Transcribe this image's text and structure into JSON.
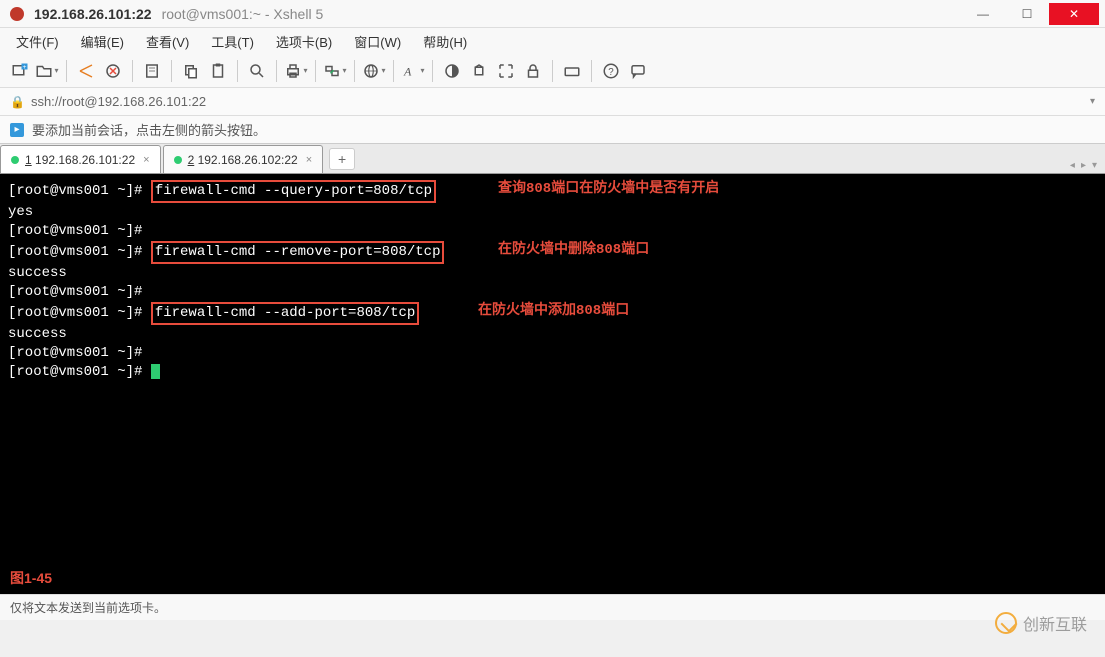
{
  "title": {
    "ip": "192.168.26.101:22",
    "session": "root@vms001:~ - Xshell 5"
  },
  "menu": {
    "file": "文件(F)",
    "edit": "编辑(E)",
    "view": "查看(V)",
    "tools": "工具(T)",
    "tabs": "选项卡(B)",
    "window": "窗口(W)",
    "help": "帮助(H)"
  },
  "address": {
    "url": "ssh://root@192.168.26.101:22"
  },
  "infobar": {
    "text": "要添加当前会话，点击左侧的箭头按钮。"
  },
  "tabs": {
    "t1_num": "1",
    "t1_label": " 192.168.26.101:22",
    "t2_num": "2",
    "t2_label": " 192.168.26.102:22"
  },
  "terminal": {
    "p1": "[root@vms001 ~]# ",
    "cmd1": "firewall-cmd --query-port=808/tcp",
    "ann1": "查询808端口在防火墙中是否有开启",
    "r1": "yes",
    "p2": "[root@vms001 ~]# ",
    "p3": "[root@vms001 ~]# ",
    "cmd2": "firewall-cmd --remove-port=808/tcp",
    "ann2": "在防火墙中删除808端口",
    "r2": "success",
    "p4": "[root@vms001 ~]# ",
    "p5": "[root@vms001 ~]# ",
    "cmd3": "firewall-cmd --add-port=808/tcp",
    "ann3": "在防火墙中添加808端口",
    "r3": "success",
    "p6": "[root@vms001 ~]# ",
    "p7": "[root@vms001 ~]# ",
    "figure": "图1-45"
  },
  "status": {
    "text": "仅将文本发送到当前选项卡。"
  },
  "watermark": {
    "text": "创新互联"
  }
}
